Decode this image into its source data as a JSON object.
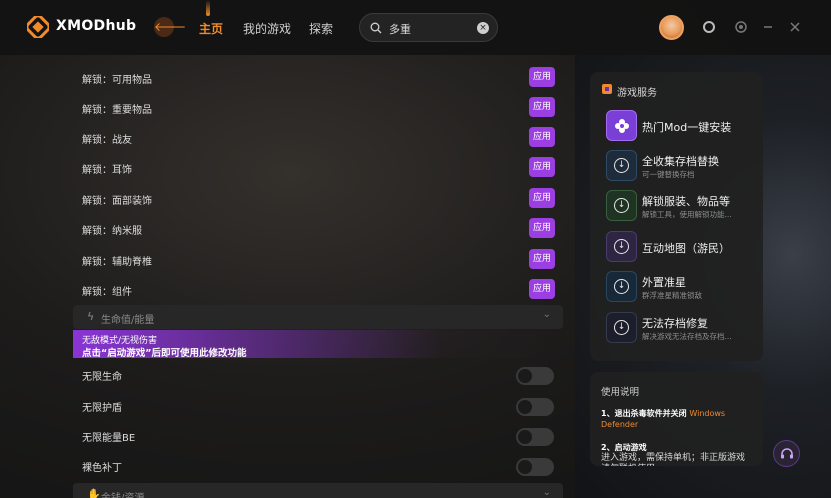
{
  "app": {
    "logo_text": "XMODhub"
  },
  "nav": {
    "back_glyph": "🡐",
    "items": [
      "主页",
      "我的游戏",
      "探索"
    ]
  },
  "search": {
    "value": "多重",
    "clear_glyph": "×"
  },
  "unlock_rows": [
    {
      "label": "解锁：可用物品",
      "button": "应用"
    },
    {
      "label": "解锁：重要物品",
      "button": "应用"
    },
    {
      "label": "解锁：战友",
      "button": "应用"
    },
    {
      "label": "解锁：耳饰",
      "button": "应用"
    },
    {
      "label": "解锁：面部装饰",
      "button": "应用"
    },
    {
      "label": "解锁：纳米服",
      "button": "应用"
    },
    {
      "label": "解锁：辅助脊椎",
      "button": "应用"
    },
    {
      "label": "解锁：组件",
      "button": "应用"
    }
  ],
  "section_health": {
    "title": "生命值/能量",
    "icon": "lightning-icon",
    "chevron": "⌄"
  },
  "notice": {
    "line1": "无敌模式/无视伤害",
    "line2": "点击“启动游戏”后即可使用此修改功能",
    "accent_color": "#8a35d6"
  },
  "toggle_rows": [
    {
      "label": "无限生命",
      "on": false
    },
    {
      "label": "无限护盾",
      "on": false
    },
    {
      "label": "无限能量BE",
      "on": false
    },
    {
      "label": "裸色补丁",
      "on": false
    }
  ],
  "section_money": {
    "title": "金钱/资源",
    "icon": "hand-icon",
    "chevron": "⌄"
  },
  "game_services": {
    "title": "游戏服务",
    "items": [
      {
        "title": "热门Mod一键安装",
        "sub": "",
        "icon": "mod-flower-icon"
      },
      {
        "title": "全收集存档替换",
        "sub": "可一键替换存档",
        "icon": "download-icon"
      },
      {
        "title": "解锁服装、物品等",
        "sub": "解锁工具，使用解锁功能...",
        "icon": "download-icon"
      },
      {
        "title": "互动地图（游民）",
        "sub": "",
        "icon": "download-icon"
      },
      {
        "title": "外置准星",
        "sub": "群浮准星精准锁敌",
        "icon": "download-icon"
      },
      {
        "title": "无法存档修复",
        "sub": "解决游戏无法存档及存档...",
        "icon": "download-icon"
      }
    ]
  },
  "instructions": {
    "title": "使用说明",
    "step1_prefix": "1、退出杀毒软件并关闭",
    "step1_highlight": "Windows Defender",
    "step2_title": "2、启动游戏",
    "step2_desc": "进入游戏，需保持单机；非正版游戏请勿联机使用"
  },
  "colors": {
    "accent": "#f08a2c",
    "apply_button": "#9b3fe3"
  }
}
